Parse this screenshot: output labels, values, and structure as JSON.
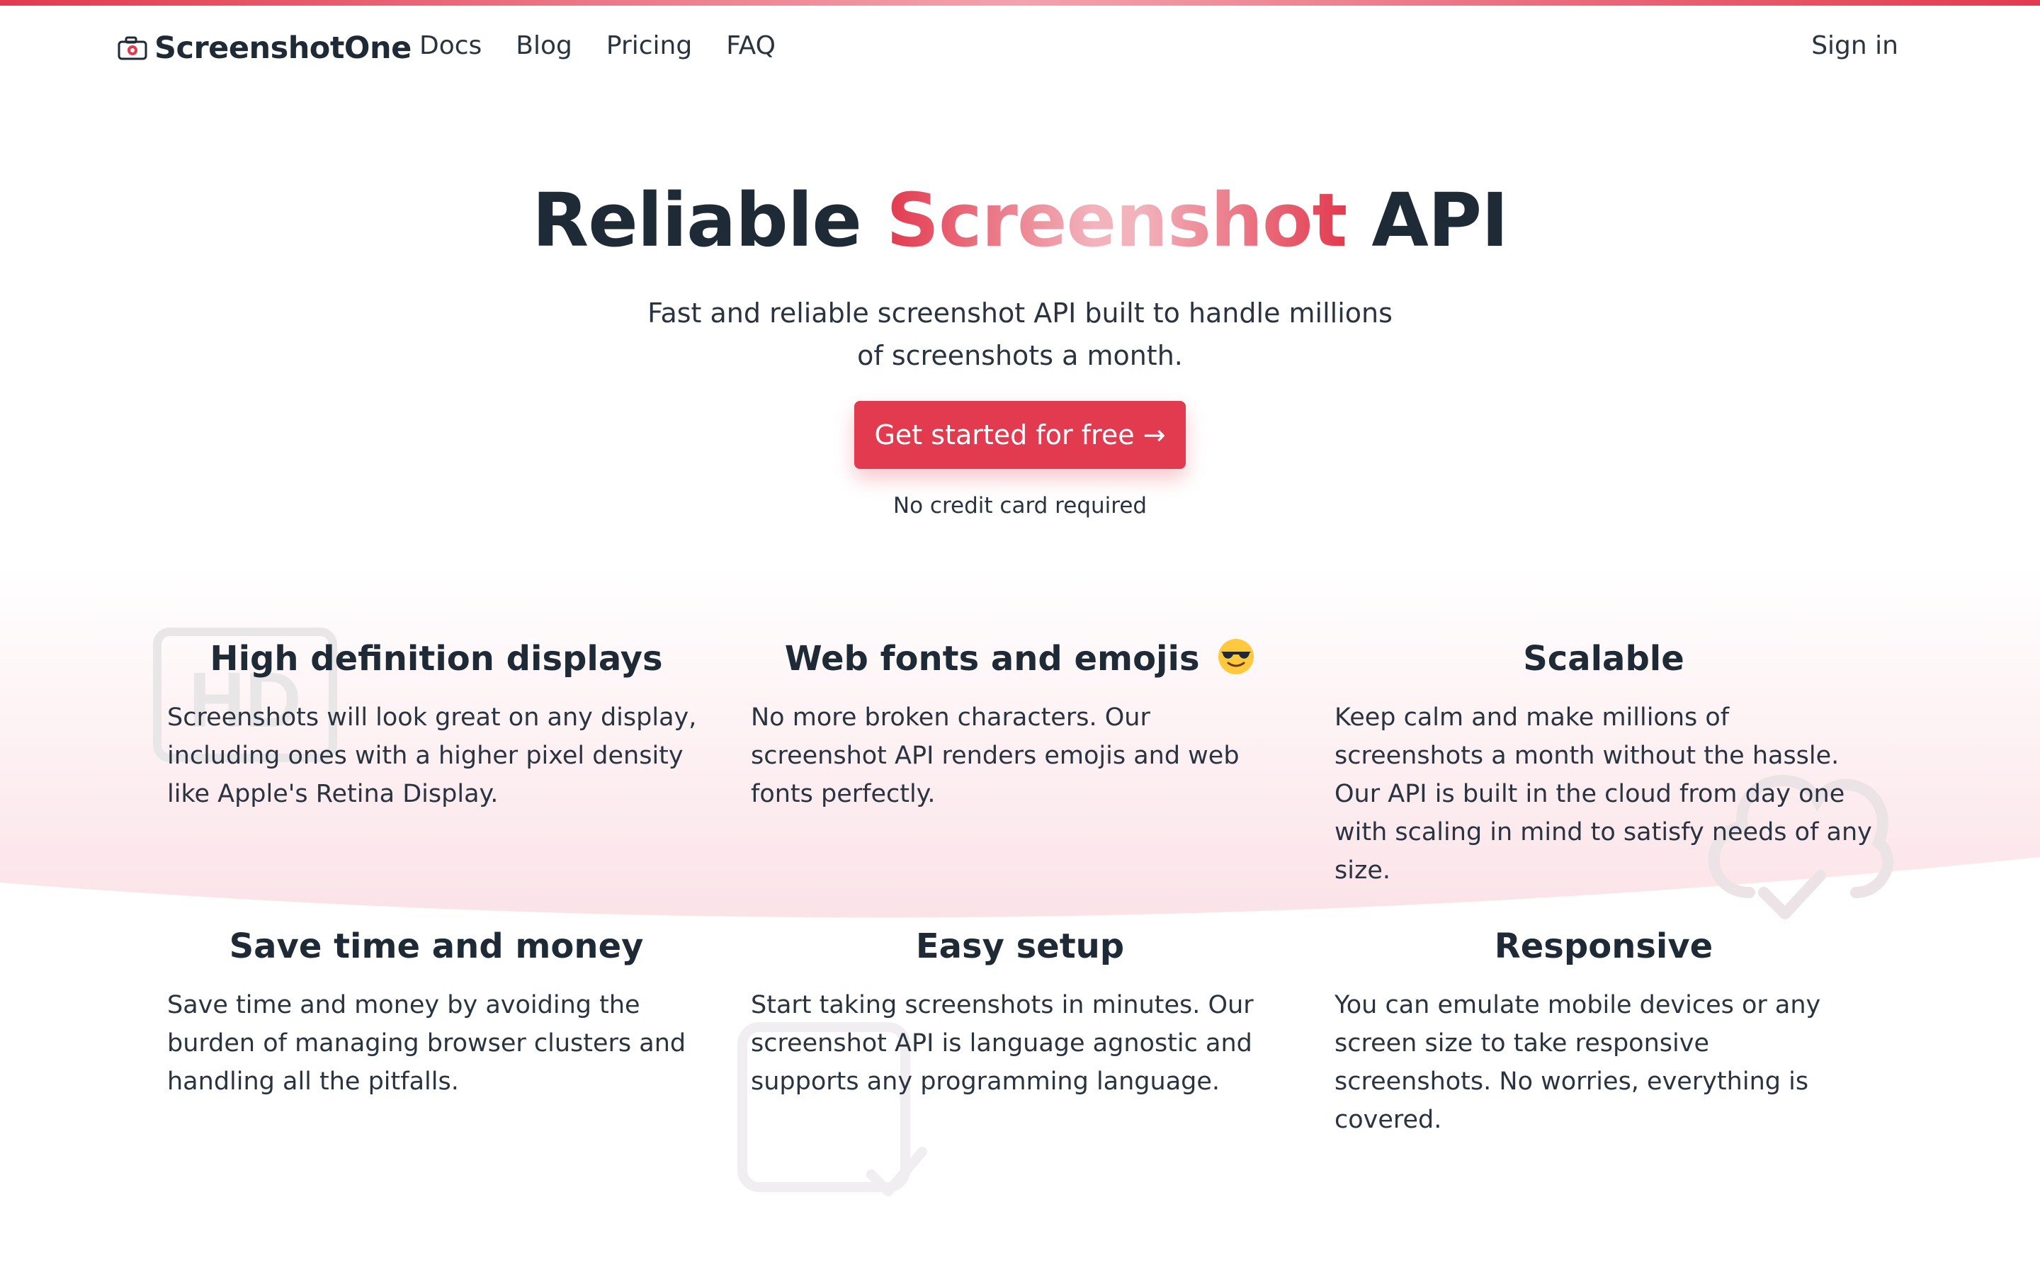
{
  "brand": {
    "name": "ScreenshotOne"
  },
  "nav": {
    "links": [
      "Docs",
      "Blog",
      "Pricing",
      "FAQ"
    ],
    "sign_in": "Sign in"
  },
  "hero": {
    "title_pre": "Reliable",
    "title_accent": "Screenshot",
    "title_post": "API",
    "subtitle": "Fast and reliable screenshot API built to handle millions of screenshots a month.",
    "cta_label": "Get started for free →",
    "cta_note": "No credit card required"
  },
  "features": [
    {
      "title": "High definition displays",
      "text": "Screenshots will look great on any display, including ones with a higher pixel density like Apple's Retina Display."
    },
    {
      "title": "Web fonts and emojis",
      "text": "No more broken characters. Our screenshot API renders emojis and web fonts perfectly."
    },
    {
      "title": "Scalable",
      "text": "Keep calm and make millions of screenshots a month without the hassle. Our API is built in the cloud from day one with scaling in mind to satisfy needs of any size."
    },
    {
      "title": "Save time and money",
      "text": "Save time and money by avoiding the burden of managing browser clusters and handling all the pitfalls."
    },
    {
      "title": "Easy setup",
      "text": "Start taking screenshots in minutes. Our screenshot API is language agnostic and supports any programming language."
    },
    {
      "title": "Responsive",
      "text": "You can emulate mobile devices or any screen size to take responsive screenshots. No worries, everything is covered."
    }
  ],
  "background_icons": {
    "hd": "HD",
    "labels": [
      "hd-icon",
      "cloud-check-icon",
      "calendar-check-icon"
    ]
  },
  "colors": {
    "accent": "#e23a4e",
    "text": "#1e2a35",
    "background_tint": "#fbe6ea"
  }
}
